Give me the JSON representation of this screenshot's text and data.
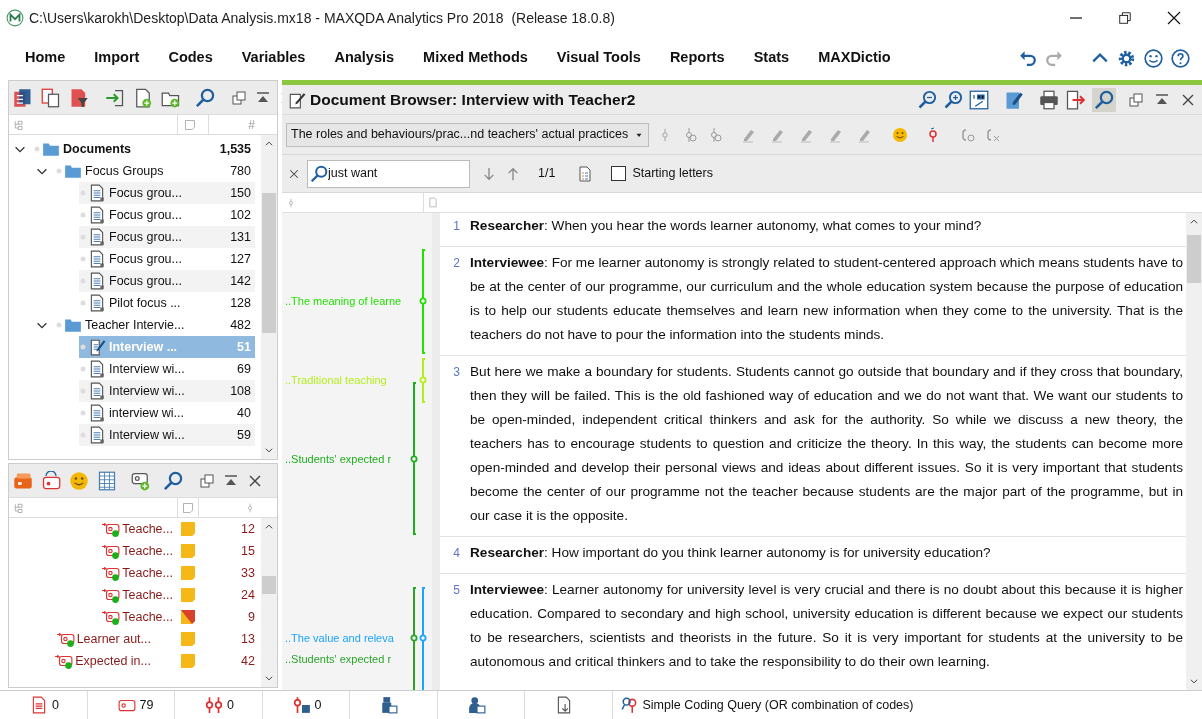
{
  "window": {
    "title": "C:\\Users\\karokh\\Desktop\\Data Analysis.mx18 - MAXQDA Analytics Pro 2018  (Release 18.0.8)"
  },
  "menu": [
    "Home",
    "Import",
    "Codes",
    "Variables",
    "Analysis",
    "Mixed Methods",
    "Visual Tools",
    "Reports",
    "Stats",
    "MAXDictio"
  ],
  "document_system": {
    "count_header": "#",
    "tree": [
      {
        "kind": "root",
        "label": "Documents",
        "count": "1,535",
        "expanded": true,
        "selected": false,
        "children": [
          {
            "kind": "folder",
            "label": "Focus Groups",
            "count": "780",
            "expanded": true,
            "selected": false,
            "children": [
              {
                "kind": "document",
                "label": "Focus grou...",
                "count": "150",
                "selected": false
              },
              {
                "kind": "document",
                "label": "Focus grou...",
                "count": "102",
                "selected": false
              },
              {
                "kind": "document",
                "label": "Focus grou...",
                "count": "131",
                "selected": false
              },
              {
                "kind": "document",
                "label": "Focus grou...",
                "count": "127",
                "selected": false
              },
              {
                "kind": "document",
                "label": "Focus grou...",
                "count": "142",
                "selected": false
              },
              {
                "kind": "document",
                "label": "Pilot focus ...",
                "count": "128",
                "selected": false
              }
            ]
          },
          {
            "kind": "folder",
            "label": "Teacher Intervie...",
            "count": "482",
            "expanded": true,
            "selected": false,
            "children": [
              {
                "kind": "document",
                "label": "Interview ...",
                "count": "51",
                "selected": true
              },
              {
                "kind": "document",
                "label": "Interview wi...",
                "count": "69",
                "selected": false
              },
              {
                "kind": "document",
                "label": "Interview wi...",
                "count": "108",
                "selected": false
              },
              {
                "kind": "document",
                "label": "interview wi...",
                "count": "40",
                "selected": false
              },
              {
                "kind": "document",
                "label": "Interview wi...",
                "count": "59",
                "selected": false
              }
            ]
          }
        ]
      }
    ]
  },
  "code_system": {
    "rows": [
      {
        "kind": "subcodes",
        "children": [
          {
            "label": "Teache...",
            "count": "12",
            "color": "#f5b818"
          },
          {
            "label": "Teache...",
            "count": "15",
            "color": "#f5b818"
          },
          {
            "label": "Teache...",
            "count": "33",
            "color": "#f5b818"
          },
          {
            "label": "Teache...",
            "count": "24",
            "color": "#f5b818"
          },
          {
            "label": "Teache...",
            "count": "9",
            "color": "#d9412b"
          }
        ]
      },
      {
        "kind": "code",
        "label": "Learner aut...",
        "count": "13",
        "color": "#f5b818"
      },
      {
        "kind": "code",
        "label": "Expected in...",
        "count": "42",
        "color": "#f5b818"
      }
    ]
  },
  "document_browser": {
    "title": "Document Browser: Interview with Teacher2",
    "code_filter": "The roles and behaviours/prac...nd teachers' actual practices",
    "search": {
      "value": "just want",
      "hits": "1/1",
      "starting_letters": false,
      "starting_letters_label": "Starting letters"
    },
    "codes": [
      {
        "label": "..The meaning of learne",
        "color": "#22e000"
      },
      {
        "label": "..Traditional teaching",
        "color": "#b4ee1a"
      },
      {
        "label": "..Students' expected r",
        "color": "#1fae1f"
      },
      {
        "label": "..The value and releva",
        "color": "#1aa3ff"
      },
      {
        "label": "..Students' expected r",
        "color": "#2aa52a"
      }
    ],
    "paragraphs": [
      {
        "number": "1",
        "text": "**Researcher**: When you hear the words learner autonomy, what comes to your mind?"
      },
      {
        "number": "2",
        "text": "**Interviewee**: For me learner autonomy is strongly related to student-centered approach which means students have to be at the center of our programme, our curriculum and the whole education system because the purpose of education is to help our students educate themselves and learn new information when they come to the university. That is the teachers do not have to pour the information into the students minds."
      },
      {
        "number": "3",
        "text": "But here we make a boundary for students. Students  cannot go outside that boundary and if they cross that boundary, then they will be failed. This is the old fashioned way of education and we do not want that. We want our students to be open-minded, independent critical thinkers and ask for the authority. So while we discuss a new theory, the teachers has to encourage students to question and criticize the theory. In this way, the students can become more open-minded and develop their personal views and ideas about different issues. So it is very important that students become the center of our programme not the teacher because students are the major part of the programme, but in our case it is the opposite."
      },
      {
        "number": "4",
        "text": "**Researcher**: How important do you think learner autonomy is for university education?"
      },
      {
        "number": "5",
        "text": "**Interviewee**: Learner autonomy for university level is very crucial and there is no doubt about this because it is higher education. Compared to secondary and high school, university education is different because we expect our students to be researchers, scientists and theorists in the future. So it is very important for students at the university to be autonomous and critical thinkers and to take the responsibility to do their own learning."
      }
    ]
  },
  "status_bar": [
    {
      "kind": "documents",
      "value": "0"
    },
    {
      "kind": "codes",
      "value": "79"
    },
    {
      "kind": "segments",
      "value": "0"
    },
    {
      "kind": "segment-docs",
      "value": "0"
    },
    {
      "kind": "doc-group"
    },
    {
      "kind": "doc-set"
    },
    {
      "kind": "export"
    },
    {
      "kind": "query",
      "value": "Simple Coding Query (OR combination of codes)"
    }
  ]
}
